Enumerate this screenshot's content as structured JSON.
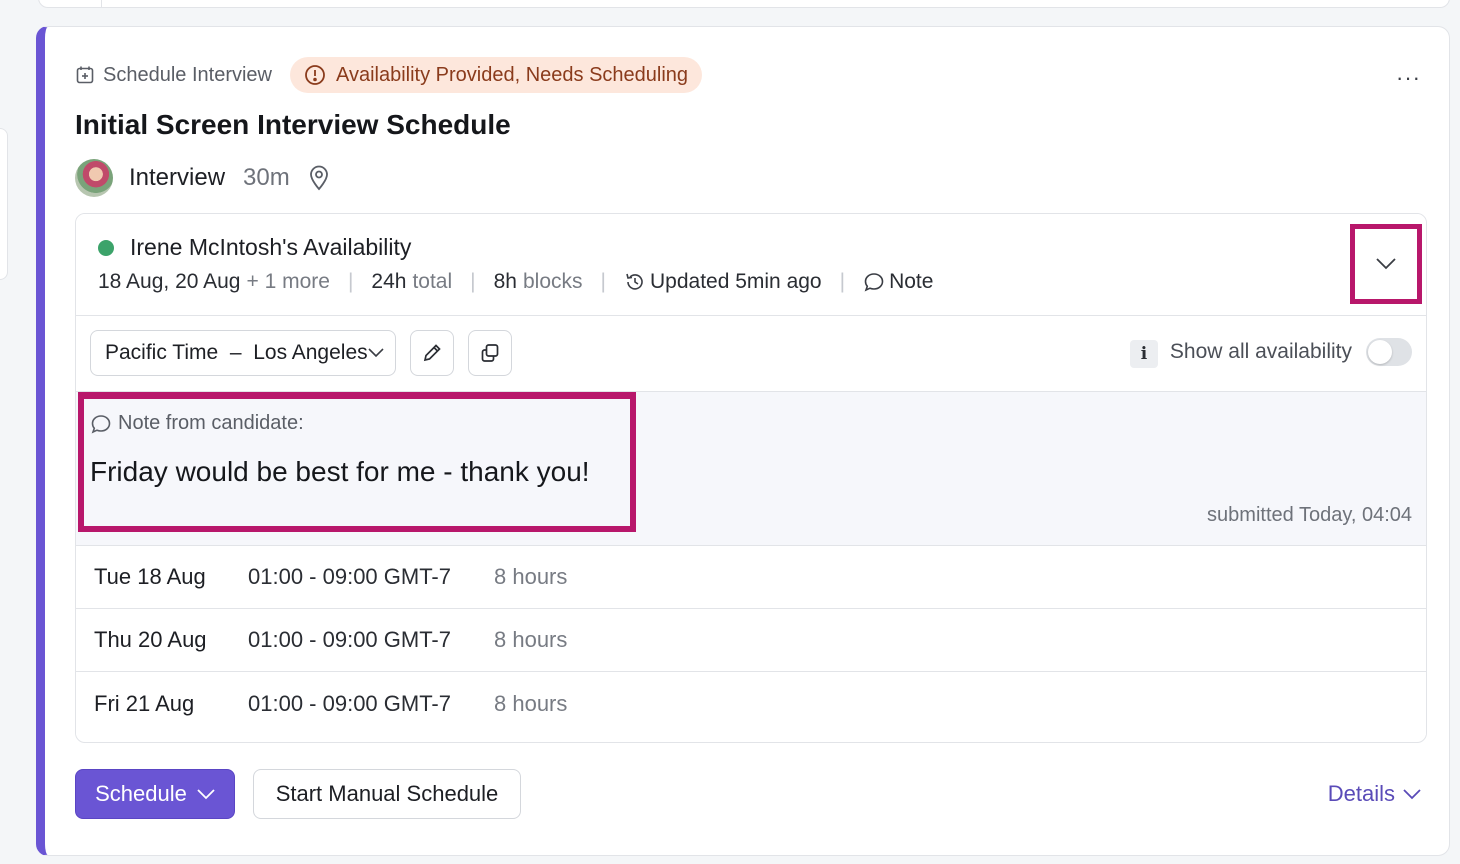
{
  "colors": {
    "accent": "#6a55d4",
    "highlight": "#b8176b",
    "status_bg": "#fde7dc",
    "status_fg": "#8a3b1c",
    "online": "#3ca36a"
  },
  "card": {
    "type_label": "Schedule Interview",
    "status_badge": "Availability Provided, Needs Scheduling",
    "more_label": "···",
    "title": "Initial Screen Interview Schedule",
    "meeting": {
      "name": "Interview",
      "duration": "30m"
    }
  },
  "availability": {
    "candidate_title": "Irene McIntosh's Availability",
    "dates": "18 Aug, 20 Aug",
    "more": "+ 1 more",
    "total_value": "24h",
    "total_unit": "total",
    "blocks_value": "8h",
    "blocks_unit": "blocks",
    "updated": "Updated 5min ago",
    "note_link": "Note",
    "timezone": "Pacific Time  –  Los Angeles",
    "info_label": "i",
    "show_all_label": "Show all availability",
    "show_all_on": false,
    "note_label": "Note from candidate:",
    "note_text": "Friday would be best for me - thank you!",
    "submitted": "submitted Today, 04:04",
    "slots": [
      {
        "date": "Tue 18 Aug",
        "time": "01:00 - 09:00 GMT-7",
        "hours": "8 hours"
      },
      {
        "date": "Thu 20 Aug",
        "time": "01:00 - 09:00 GMT-7",
        "hours": "8 hours"
      },
      {
        "date": "Fri 21 Aug",
        "time": "01:00 - 09:00 GMT-7",
        "hours": "8 hours"
      }
    ]
  },
  "actions": {
    "schedule": "Schedule",
    "manual": "Start Manual Schedule",
    "details": "Details"
  }
}
